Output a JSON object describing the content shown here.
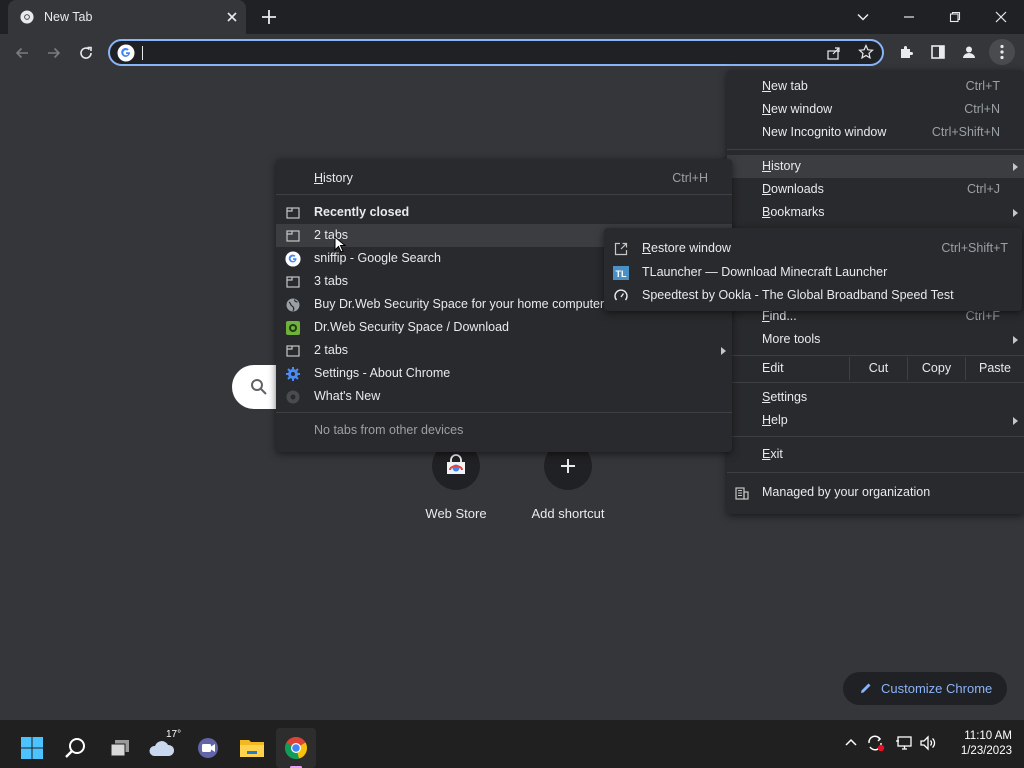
{
  "tab": {
    "title": "New Tab"
  },
  "omnibox": {
    "value": "",
    "placeholder": ""
  },
  "chrome_menu": {
    "new_tab": {
      "label": "New tab",
      "shortcut": "Ctrl+T"
    },
    "new_window": {
      "label": "New window",
      "shortcut": "Ctrl+N"
    },
    "new_incognito": {
      "label": "New Incognito window",
      "shortcut": "Ctrl+Shift+N"
    },
    "history": {
      "label": "History"
    },
    "downloads": {
      "label": "Downloads",
      "shortcut": "Ctrl+J"
    },
    "bookmarks": {
      "label": "Bookmarks"
    },
    "find": {
      "label": "Find...",
      "shortcut": "Ctrl+F"
    },
    "more_tools": {
      "label": "More tools"
    },
    "edit": {
      "label": "Edit",
      "cut": "Cut",
      "copy": "Copy",
      "paste": "Paste"
    },
    "settings": {
      "label": "Settings"
    },
    "help": {
      "label": "Help"
    },
    "exit": {
      "label": "Exit"
    },
    "managed": {
      "label": "Managed by your organization"
    }
  },
  "history_menu": {
    "history": {
      "label": "History",
      "shortcut": "Ctrl+H"
    },
    "recently_closed": "Recently closed",
    "items": [
      {
        "label": "2 tabs",
        "icon": "tab-group-icon"
      },
      {
        "label": "sniffip - Google Search",
        "icon": "google-icon"
      },
      {
        "label": "3 tabs",
        "icon": "tab-group-icon"
      },
      {
        "label": "Buy Dr.Web Security Space for your home computer an",
        "icon": "globe-icon"
      },
      {
        "label": "Dr.Web Security Space / Download",
        "icon": "drweb-icon"
      },
      {
        "label": "2 tabs",
        "icon": "tab-group-icon"
      },
      {
        "label": "Settings - About Chrome",
        "icon": "settings-gear-icon"
      },
      {
        "label": "What's New",
        "icon": "chrome-icon"
      }
    ],
    "other_devices": "No tabs from other devices"
  },
  "recent_sub": {
    "restore": {
      "label": "Restore window",
      "shortcut": "Ctrl+Shift+T"
    },
    "items": [
      {
        "label": "TLauncher — Download Minecraft Launcher",
        "icon": "tlauncher-icon"
      },
      {
        "label": "Speedtest by Ookla - The Global Broadband Speed Test",
        "icon": "speedtest-icon"
      }
    ]
  },
  "ntp": {
    "shortcuts": [
      {
        "label": "Web Store"
      },
      {
        "label": "Add shortcut"
      }
    ],
    "customize": "Customize Chrome"
  },
  "taskbar": {
    "weather": "17°",
    "time": "11:10 AM",
    "date": "1/23/2023"
  },
  "colors": {
    "accent": "#8ab4f8",
    "menu_bg": "#292a2d",
    "frame": "#202124",
    "page": "#35363a",
    "taskbar": "#202020"
  }
}
